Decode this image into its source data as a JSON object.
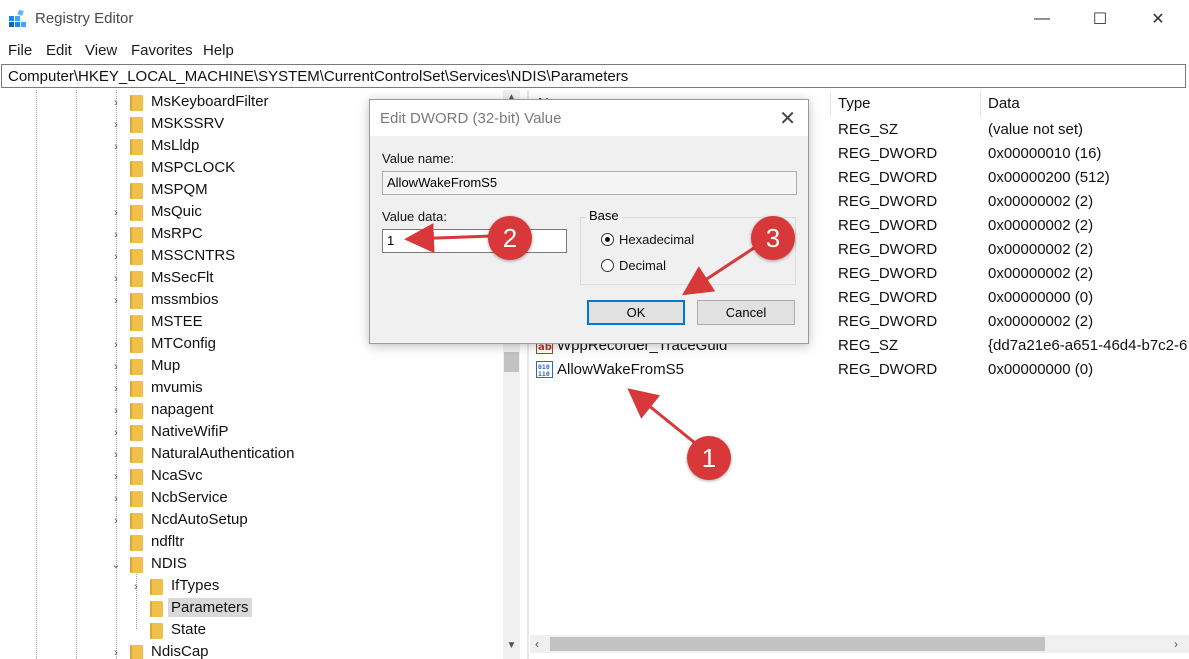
{
  "window": {
    "title": "Registry Editor",
    "minimize": "—",
    "maximize": "☐",
    "close": "✕"
  },
  "menu": [
    "File",
    "Edit",
    "View",
    "Favorites",
    "Help"
  ],
  "address": "Computer\\HKEY_LOCAL_MACHINE\\SYSTEM\\CurrentControlSet\\Services\\NDIS\\Parameters",
  "tree": {
    "items": [
      {
        "label": "MsKeyboardFilter",
        "expander": "›"
      },
      {
        "label": "MSKSSRV",
        "expander": "›"
      },
      {
        "label": "MsLldp",
        "expander": "›"
      },
      {
        "label": "MSPCLOCK",
        "expander": ""
      },
      {
        "label": "MSPQM",
        "expander": ""
      },
      {
        "label": "MsQuic",
        "expander": "›"
      },
      {
        "label": "MsRPC",
        "expander": "›"
      },
      {
        "label": "MSSCNTRS",
        "expander": "›"
      },
      {
        "label": "MsSecFlt",
        "expander": "›"
      },
      {
        "label": "mssmbios",
        "expander": "›"
      },
      {
        "label": "MSTEE",
        "expander": ""
      },
      {
        "label": "MTConfig",
        "expander": "›"
      },
      {
        "label": "Mup",
        "expander": "›"
      },
      {
        "label": "mvumis",
        "expander": "›"
      },
      {
        "label": "napagent",
        "expander": "›"
      },
      {
        "label": "NativeWifiP",
        "expander": "›"
      },
      {
        "label": "NaturalAuthentication",
        "expander": "›"
      },
      {
        "label": "NcaSvc",
        "expander": "›"
      },
      {
        "label": "NcbService",
        "expander": "›"
      },
      {
        "label": "NcdAutoSetup",
        "expander": "›"
      },
      {
        "label": "ndfltr",
        "expander": ""
      },
      {
        "label": "NDIS",
        "expander": "⌄"
      },
      {
        "label": "IfTypes",
        "expander": "›"
      },
      {
        "label": "Parameters",
        "expander": ""
      },
      {
        "label": "State",
        "expander": ""
      },
      {
        "label": "NdisCap",
        "expander": "›"
      }
    ]
  },
  "values": {
    "headers": {
      "name": "Name",
      "type": "Type",
      "data": "Data"
    },
    "rows": [
      {
        "name": "",
        "type": "REG_SZ",
        "data": "(value not set)",
        "icon": "string-value-icon"
      },
      {
        "name": "",
        "type": "REG_DWORD",
        "data": "0x00000010 (16)",
        "icon": "binary-value-icon"
      },
      {
        "name": "",
        "type": "REG_DWORD",
        "data": "0x00000200 (512)",
        "icon": "binary-value-icon"
      },
      {
        "name": "",
        "type": "REG_DWORD",
        "data": "0x00000002 (2)",
        "icon": "binary-value-icon"
      },
      {
        "name": "",
        "type": "REG_DWORD",
        "data": "0x00000002 (2)",
        "icon": "binary-value-icon"
      },
      {
        "name": "",
        "type": "REG_DWORD",
        "data": "0x00000002 (2)",
        "icon": "binary-value-icon"
      },
      {
        "name": "",
        "type": "REG_DWORD",
        "data": "0x00000002 (2)",
        "icon": "binary-value-icon"
      },
      {
        "name": "",
        "type": "REG_DWORD",
        "data": "0x00000000 (0)",
        "icon": "binary-value-icon"
      },
      {
        "name": "",
        "type": "REG_DWORD",
        "data": "0x00000002 (2)",
        "icon": "binary-value-icon"
      },
      {
        "name": "WppRecorder_TraceGuid",
        "type": "REG_SZ",
        "data": "{dd7a21e6-a651-46d4-b7c2-6",
        "icon": "string-value-icon"
      },
      {
        "name": "AllowWakeFromS5",
        "type": "REG_DWORD",
        "data": "0x00000000 (0)",
        "icon": "binary-value-icon"
      }
    ]
  },
  "dialog": {
    "title": "Edit DWORD (32-bit) Value",
    "close": "✕",
    "value_name_label": "Value name:",
    "value_name": "AllowWakeFromS5",
    "value_data_label": "Value data:",
    "value_data": "1",
    "base_label": "Base",
    "hex_label": "Hexadecimal",
    "dec_label": "Decimal",
    "selected_base": "Hexadecimal",
    "ok": "OK",
    "cancel": "Cancel"
  },
  "annotations": {
    "badge_1": "1",
    "badge_2": "2",
    "badge_3": "3",
    "color": "#d8383a"
  }
}
